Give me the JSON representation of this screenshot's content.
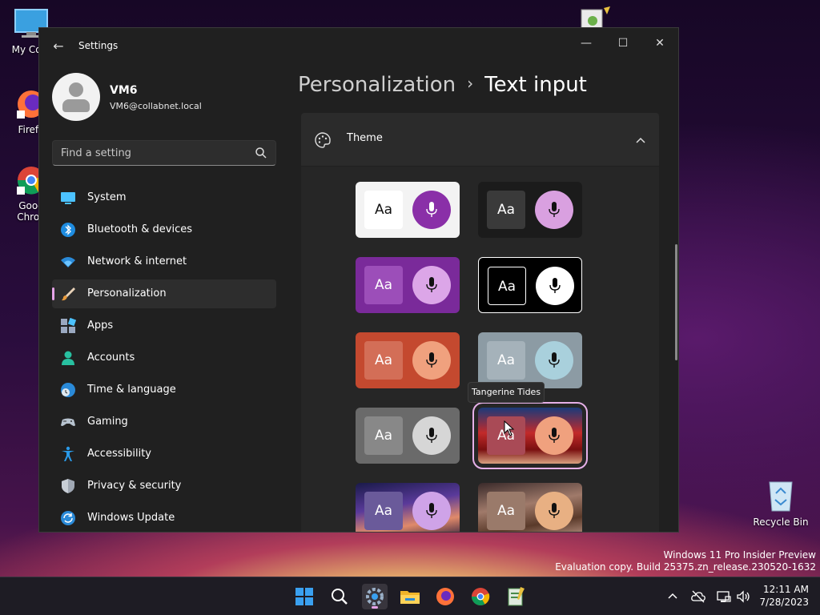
{
  "desktop": {
    "icons": [
      {
        "label": "My Com"
      },
      {
        "label": "Firefo"
      },
      {
        "label": "Goog Chron"
      },
      {
        "label": ""
      },
      {
        "label": "Recycle Bin"
      }
    ],
    "watermark": {
      "line1": "Windows 11 Pro Insider Preview",
      "line2": "Evaluation copy. Build 25375.zn_release.230520-1632"
    }
  },
  "window": {
    "title": "Settings",
    "controls": {
      "minimize": "—",
      "maximize": "☐",
      "close": "✕"
    },
    "back_icon": "←"
  },
  "profile": {
    "name": "VM6",
    "email": "VM6@collabnet.local"
  },
  "search": {
    "placeholder": "Find a setting"
  },
  "nav": {
    "items": [
      {
        "label": "System",
        "icon": "monitor-icon"
      },
      {
        "label": "Bluetooth & devices",
        "icon": "bluetooth-icon"
      },
      {
        "label": "Network & internet",
        "icon": "wifi-icon"
      },
      {
        "label": "Personalization",
        "icon": "brush-icon",
        "active": true
      },
      {
        "label": "Apps",
        "icon": "apps-icon"
      },
      {
        "label": "Accounts",
        "icon": "person-icon"
      },
      {
        "label": "Time & language",
        "icon": "globe-clock-icon"
      },
      {
        "label": "Gaming",
        "icon": "gamepad-icon"
      },
      {
        "label": "Accessibility",
        "icon": "accessibility-icon"
      },
      {
        "label": "Privacy & security",
        "icon": "shield-icon"
      },
      {
        "label": "Windows Update",
        "icon": "update-icon"
      }
    ]
  },
  "breadcrumb": {
    "parent": "Personalization",
    "separator": "›",
    "current": "Text input"
  },
  "theme_section": {
    "title": "Theme",
    "expanded": true,
    "tooltip": "Tangerine Tides",
    "cards": [
      {
        "aa": "Aa",
        "bg": "#f3f3f3",
        "aa_bg": "#ffffff",
        "aa_color": "#111111",
        "mic_bg": "#8a2fa8",
        "mic_color": "#ffffff"
      },
      {
        "aa": "Aa",
        "bg": "#1b1b1b",
        "aa_bg": "#3a3a3a",
        "aa_color": "#ffffff",
        "mic_bg": "#d9a0e0",
        "mic_color": "#111111"
      },
      {
        "aa": "Aa",
        "bg": "#7a2a9a",
        "aa_bg": "#9c4eb9",
        "aa_color": "#ffffff",
        "mic_bg": "#dca6e8",
        "mic_color": "#111111"
      },
      {
        "aa": "Aa",
        "bg": "#000000",
        "aa_bg": "#000000",
        "aa_color": "#ffffff",
        "mic_bg": "#ffffff",
        "mic_color": "#000000",
        "outlined": true
      },
      {
        "aa": "Aa",
        "bg": "#c4492f",
        "aa_bg": "#d36e57",
        "aa_color": "#ffffff",
        "mic_bg": "#f0a17e",
        "mic_color": "#111111"
      },
      {
        "aa": "Aa",
        "bg": "#8c9ba4",
        "aa_bg": "#a5b2ba",
        "aa_color": "#ffffff",
        "mic_bg": "#a9d0dc",
        "mic_color": "#111111"
      },
      {
        "aa": "Aa",
        "bg": "#6a6a6a",
        "aa_bg": "#888888",
        "aa_color": "#ffffff",
        "mic_bg": "#d6d6d6",
        "mic_color": "#111111"
      },
      {
        "aa": "Aa",
        "bg": "#8c1c22",
        "aa_bg": "#a94a56",
        "aa_color": "#ffffff",
        "mic_bg": "#f0a17e",
        "mic_color": "#111111",
        "selected": true
      },
      {
        "aa": "Aa",
        "bg": "#3a2a6a",
        "aa_bg": "#6a5a9a",
        "aa_color": "#ffffff",
        "mic_bg": "#cfa3e8",
        "mic_color": "#111111"
      },
      {
        "aa": "Aa",
        "bg": "#6a4a3a",
        "aa_bg": "#9a7a6a",
        "aa_color": "#ffffff",
        "mic_bg": "#e8b083",
        "mic_color": "#111111"
      }
    ]
  },
  "taskbar": {
    "apps": [
      "start-icon",
      "search-icon",
      "settings-icon",
      "file-explorer-icon",
      "firefox-icon",
      "chrome-icon",
      "notepad-icon"
    ],
    "clock": {
      "time": "12:11 AM",
      "date": "7/28/2023"
    },
    "tray": {
      "chevron": "^"
    }
  },
  "colors": {
    "accent": "#e6a3e8",
    "window_bg": "#202020",
    "card_bg": "#2b2b2b"
  }
}
